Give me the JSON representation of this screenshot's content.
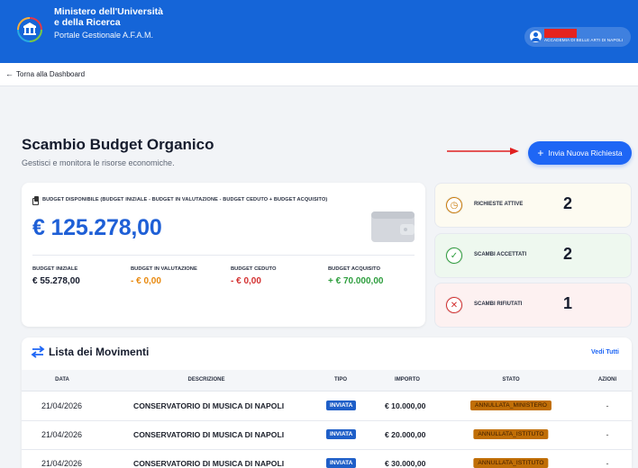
{
  "header": {
    "ministry_line1": "Ministero dell'Università",
    "ministry_line2": "e della Ricerca",
    "portal": "Portale Gestionale A.F.A.M.",
    "user_institution": "ACCADEMIA DI BELLE ARTI DI NAPOLI"
  },
  "nav": {
    "back_label": "Torna alla Dashboard",
    "back_arrow": "←"
  },
  "page": {
    "title": "Scambio Budget Organico",
    "subtitle": "Gestisci e monitora le risorse economiche.",
    "new_request_plus": "+",
    "new_request_label": "Invia Nuova Richiesta"
  },
  "budget": {
    "heading": "BUDGET DISPONIBILE (BUDGET INIZIALE - BUDGET IN VALUTAZIONE - BUDGET CEDUTO + BUDGET ACQUISITO)",
    "available": "€ 125.278,00",
    "columns": [
      {
        "label": "BUDGET INIZIALE",
        "value": "€ 55.278,00",
        "color": "#161c2d"
      },
      {
        "label": "BUDGET IN VALUTAZIONE",
        "value": "- € 0,00",
        "color": "#e8880c"
      },
      {
        "label": "BUDGET CEDUTO",
        "value": "- € 0,00",
        "color": "#d32f2f"
      },
      {
        "label": "BUDGET ACQUISITO",
        "value": "+ € 70.000,00",
        "color": "#2e9e3e"
      }
    ]
  },
  "stats": [
    {
      "label": "RICHIESTE ATTIVE",
      "count": "2",
      "icon": "clock-icon",
      "glyph": "◷",
      "bg": "#fdfbf1",
      "icon_color": "#c97b0a"
    },
    {
      "label": "SCAMBI ACCETTATI",
      "count": "2",
      "icon": "check-circle-icon",
      "glyph": "✓",
      "bg": "#eef8ef",
      "icon_color": "#2e9e3e"
    },
    {
      "label": "SCAMBI RIFIUTATI",
      "count": "1",
      "icon": "x-circle-icon",
      "glyph": "✕",
      "bg": "#fdf1f1",
      "icon_color": "#d32f2f"
    }
  ],
  "movements": {
    "title": "Lista dei Movimenti",
    "see_all": "Vedi Tutti",
    "headers": {
      "date": "DATA",
      "description": "DESCRIZIONE",
      "type": "TIPO",
      "amount": "IMPORTO",
      "status": "STATO",
      "actions": "AZIONI"
    },
    "rows": [
      {
        "date": "21/04/2026",
        "description": "CONSERVATORIO DI MUSICA DI NAPOLI",
        "type": "INVIATA",
        "amount": "€ 10.000,00",
        "status": "ANNULLATA_MINISTERO",
        "actions": "-"
      },
      {
        "date": "21/04/2026",
        "description": "CONSERVATORIO DI MUSICA DI NAPOLI",
        "type": "INVIATA",
        "amount": "€ 20.000,00",
        "status": "ANNULLATA_ISTITUTO",
        "actions": "-"
      },
      {
        "date": "21/04/2026",
        "description": "CONSERVATORIO DI MUSICA DI NAPOLI",
        "type": "INVIATA",
        "amount": "€ 30.000,00",
        "status": "ANNULLATA_ISTITUTO",
        "actions": "-"
      }
    ]
  }
}
